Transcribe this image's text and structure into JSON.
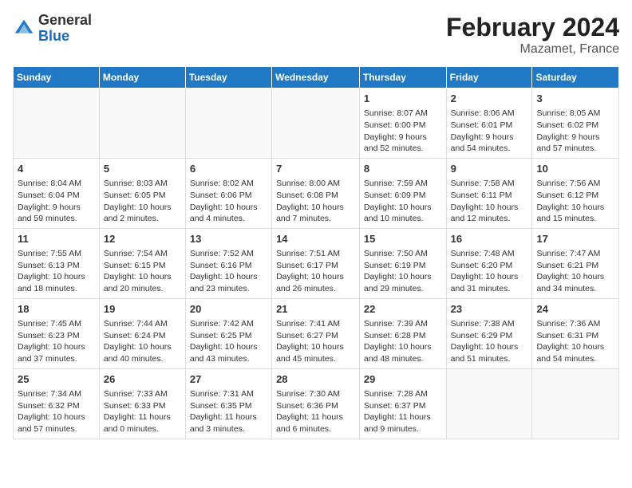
{
  "header": {
    "logo_general": "General",
    "logo_blue": "Blue",
    "title": "February 2024",
    "subtitle": "Mazamet, France"
  },
  "days_of_week": [
    "Sunday",
    "Monday",
    "Tuesday",
    "Wednesday",
    "Thursday",
    "Friday",
    "Saturday"
  ],
  "weeks": [
    [
      {
        "num": "",
        "info": ""
      },
      {
        "num": "",
        "info": ""
      },
      {
        "num": "",
        "info": ""
      },
      {
        "num": "",
        "info": ""
      },
      {
        "num": "1",
        "info": "Sunrise: 8:07 AM\nSunset: 6:00 PM\nDaylight: 9 hours\nand 52 minutes."
      },
      {
        "num": "2",
        "info": "Sunrise: 8:06 AM\nSunset: 6:01 PM\nDaylight: 9 hours\nand 54 minutes."
      },
      {
        "num": "3",
        "info": "Sunrise: 8:05 AM\nSunset: 6:02 PM\nDaylight: 9 hours\nand 57 minutes."
      }
    ],
    [
      {
        "num": "4",
        "info": "Sunrise: 8:04 AM\nSunset: 6:04 PM\nDaylight: 9 hours\nand 59 minutes."
      },
      {
        "num": "5",
        "info": "Sunrise: 8:03 AM\nSunset: 6:05 PM\nDaylight: 10 hours\nand 2 minutes."
      },
      {
        "num": "6",
        "info": "Sunrise: 8:02 AM\nSunset: 6:06 PM\nDaylight: 10 hours\nand 4 minutes."
      },
      {
        "num": "7",
        "info": "Sunrise: 8:00 AM\nSunset: 6:08 PM\nDaylight: 10 hours\nand 7 minutes."
      },
      {
        "num": "8",
        "info": "Sunrise: 7:59 AM\nSunset: 6:09 PM\nDaylight: 10 hours\nand 10 minutes."
      },
      {
        "num": "9",
        "info": "Sunrise: 7:58 AM\nSunset: 6:11 PM\nDaylight: 10 hours\nand 12 minutes."
      },
      {
        "num": "10",
        "info": "Sunrise: 7:56 AM\nSunset: 6:12 PM\nDaylight: 10 hours\nand 15 minutes."
      }
    ],
    [
      {
        "num": "11",
        "info": "Sunrise: 7:55 AM\nSunset: 6:13 PM\nDaylight: 10 hours\nand 18 minutes."
      },
      {
        "num": "12",
        "info": "Sunrise: 7:54 AM\nSunset: 6:15 PM\nDaylight: 10 hours\nand 20 minutes."
      },
      {
        "num": "13",
        "info": "Sunrise: 7:52 AM\nSunset: 6:16 PM\nDaylight: 10 hours\nand 23 minutes."
      },
      {
        "num": "14",
        "info": "Sunrise: 7:51 AM\nSunset: 6:17 PM\nDaylight: 10 hours\nand 26 minutes."
      },
      {
        "num": "15",
        "info": "Sunrise: 7:50 AM\nSunset: 6:19 PM\nDaylight: 10 hours\nand 29 minutes."
      },
      {
        "num": "16",
        "info": "Sunrise: 7:48 AM\nSunset: 6:20 PM\nDaylight: 10 hours\nand 31 minutes."
      },
      {
        "num": "17",
        "info": "Sunrise: 7:47 AM\nSunset: 6:21 PM\nDaylight: 10 hours\nand 34 minutes."
      }
    ],
    [
      {
        "num": "18",
        "info": "Sunrise: 7:45 AM\nSunset: 6:23 PM\nDaylight: 10 hours\nand 37 minutes."
      },
      {
        "num": "19",
        "info": "Sunrise: 7:44 AM\nSunset: 6:24 PM\nDaylight: 10 hours\nand 40 minutes."
      },
      {
        "num": "20",
        "info": "Sunrise: 7:42 AM\nSunset: 6:25 PM\nDaylight: 10 hours\nand 43 minutes."
      },
      {
        "num": "21",
        "info": "Sunrise: 7:41 AM\nSunset: 6:27 PM\nDaylight: 10 hours\nand 45 minutes."
      },
      {
        "num": "22",
        "info": "Sunrise: 7:39 AM\nSunset: 6:28 PM\nDaylight: 10 hours\nand 48 minutes."
      },
      {
        "num": "23",
        "info": "Sunrise: 7:38 AM\nSunset: 6:29 PM\nDaylight: 10 hours\nand 51 minutes."
      },
      {
        "num": "24",
        "info": "Sunrise: 7:36 AM\nSunset: 6:31 PM\nDaylight: 10 hours\nand 54 minutes."
      }
    ],
    [
      {
        "num": "25",
        "info": "Sunrise: 7:34 AM\nSunset: 6:32 PM\nDaylight: 10 hours\nand 57 minutes."
      },
      {
        "num": "26",
        "info": "Sunrise: 7:33 AM\nSunset: 6:33 PM\nDaylight: 11 hours\nand 0 minutes."
      },
      {
        "num": "27",
        "info": "Sunrise: 7:31 AM\nSunset: 6:35 PM\nDaylight: 11 hours\nand 3 minutes."
      },
      {
        "num": "28",
        "info": "Sunrise: 7:30 AM\nSunset: 6:36 PM\nDaylight: 11 hours\nand 6 minutes."
      },
      {
        "num": "29",
        "info": "Sunrise: 7:28 AM\nSunset: 6:37 PM\nDaylight: 11 hours\nand 9 minutes."
      },
      {
        "num": "",
        "info": ""
      },
      {
        "num": "",
        "info": ""
      }
    ]
  ]
}
